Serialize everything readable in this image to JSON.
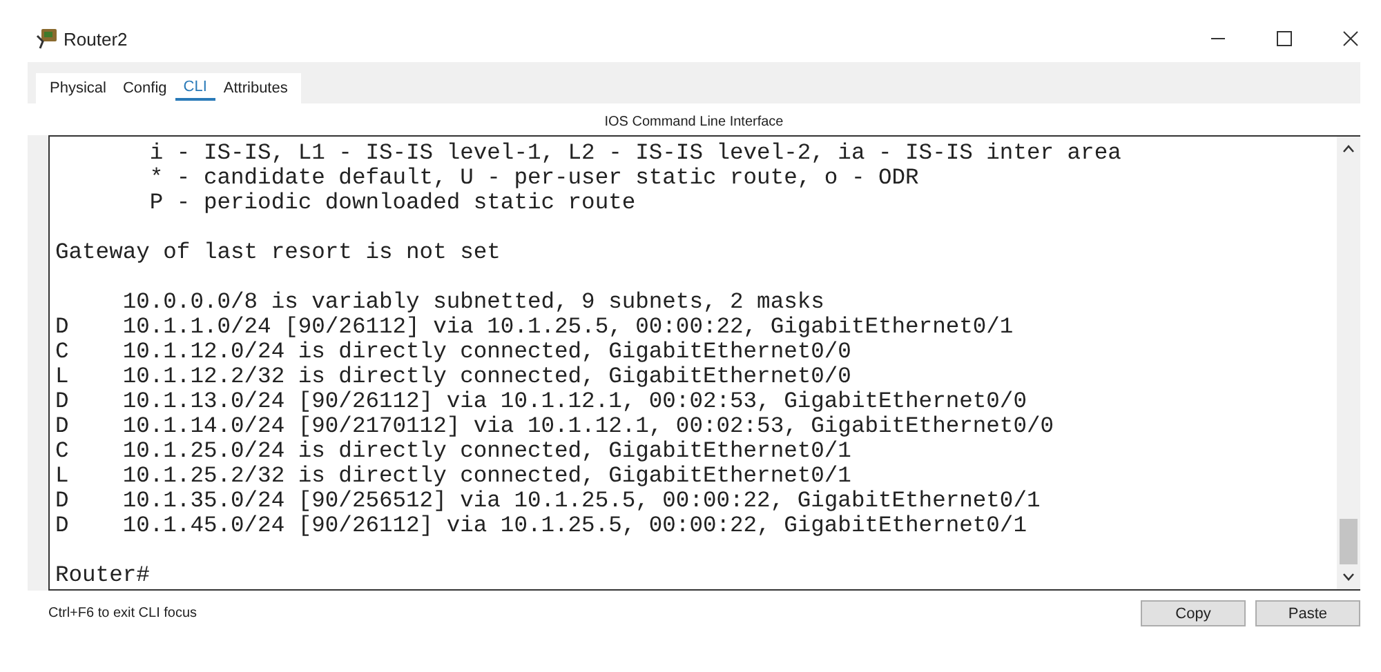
{
  "window": {
    "title": "Router2"
  },
  "tabs": [
    {
      "label": "Physical",
      "selected": false
    },
    {
      "label": "Config",
      "selected": false
    },
    {
      "label": "CLI",
      "selected": true
    },
    {
      "label": "Attributes",
      "selected": false
    }
  ],
  "cli": {
    "heading": "IOS Command Line Interface",
    "lines": [
      {
        "text": "       i - IS-IS, L1 - IS-IS level-1, L2 - IS-IS level-2, ia - IS-IS inter area",
        "blank_before": false
      },
      {
        "text": "       * - candidate default, U - per-user static route, o - ODR",
        "blank_before": false
      },
      {
        "text": "       P - periodic downloaded static route",
        "blank_before": false
      },
      {
        "text": "Gateway of last resort is not set",
        "blank_before": true
      },
      {
        "text": "     10.0.0.0/8 is variably subnetted, 9 subnets, 2 masks",
        "blank_before": true
      },
      {
        "text": "D    10.1.1.0/24 [90/26112] via 10.1.25.5, 00:00:22, GigabitEthernet0/1",
        "blank_before": false
      },
      {
        "text": "C    10.1.12.0/24 is directly connected, GigabitEthernet0/0",
        "blank_before": false
      },
      {
        "text": "L    10.1.12.2/32 is directly connected, GigabitEthernet0/0",
        "blank_before": false
      },
      {
        "text": "D    10.1.13.0/24 [90/26112] via 10.1.12.1, 00:02:53, GigabitEthernet0/0",
        "blank_before": false
      },
      {
        "text": "D    10.1.14.0/24 [90/2170112] via 10.1.12.1, 00:02:53, GigabitEthernet0/0",
        "blank_before": false
      },
      {
        "text": "C    10.1.25.0/24 is directly connected, GigabitEthernet0/1",
        "blank_before": false
      },
      {
        "text": "L    10.1.25.2/32 is directly connected, GigabitEthernet0/1",
        "blank_before": false
      },
      {
        "text": "D    10.1.35.0/24 [90/256512] via 10.1.25.5, 00:00:22, GigabitEthernet0/1",
        "blank_before": false
      },
      {
        "text": "D    10.1.45.0/24 [90/26112] via 10.1.25.5, 00:00:22, GigabitEthernet0/1",
        "blank_before": false
      },
      {
        "text": "Router#",
        "blank_before": true
      }
    ]
  },
  "status_bar": {
    "hint": "Ctrl+F6 to exit CLI focus"
  },
  "buttons": [
    "Copy",
    "Paste"
  ]
}
